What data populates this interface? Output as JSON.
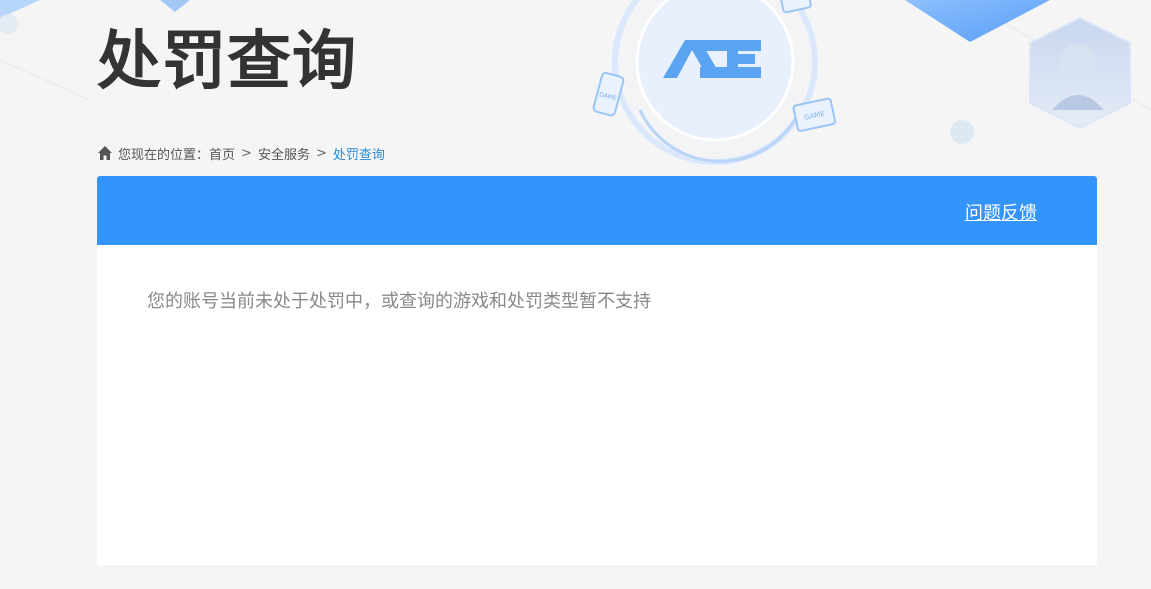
{
  "header": {
    "title": "处罚查询",
    "logo_text": "ACE",
    "badge_text": "GAME"
  },
  "breadcrumb": {
    "prefix": "您现在的位置：",
    "items": [
      "首页",
      "安全服务",
      "处罚查询"
    ],
    "separator": ">"
  },
  "panel": {
    "feedback_label": "问题反馈",
    "message": "您的账号当前未处于处罚中，或查询的游戏和处罚类型暂不支持"
  },
  "colors": {
    "accent": "#3394fc",
    "link_current": "#2b8ad6",
    "title": "#333333",
    "background": "#f5f5f6"
  },
  "icons": [
    "home-icon",
    "ace-logo-icon",
    "game-phone-icon",
    "game-monitor-icon",
    "character-avatar-icon"
  ]
}
